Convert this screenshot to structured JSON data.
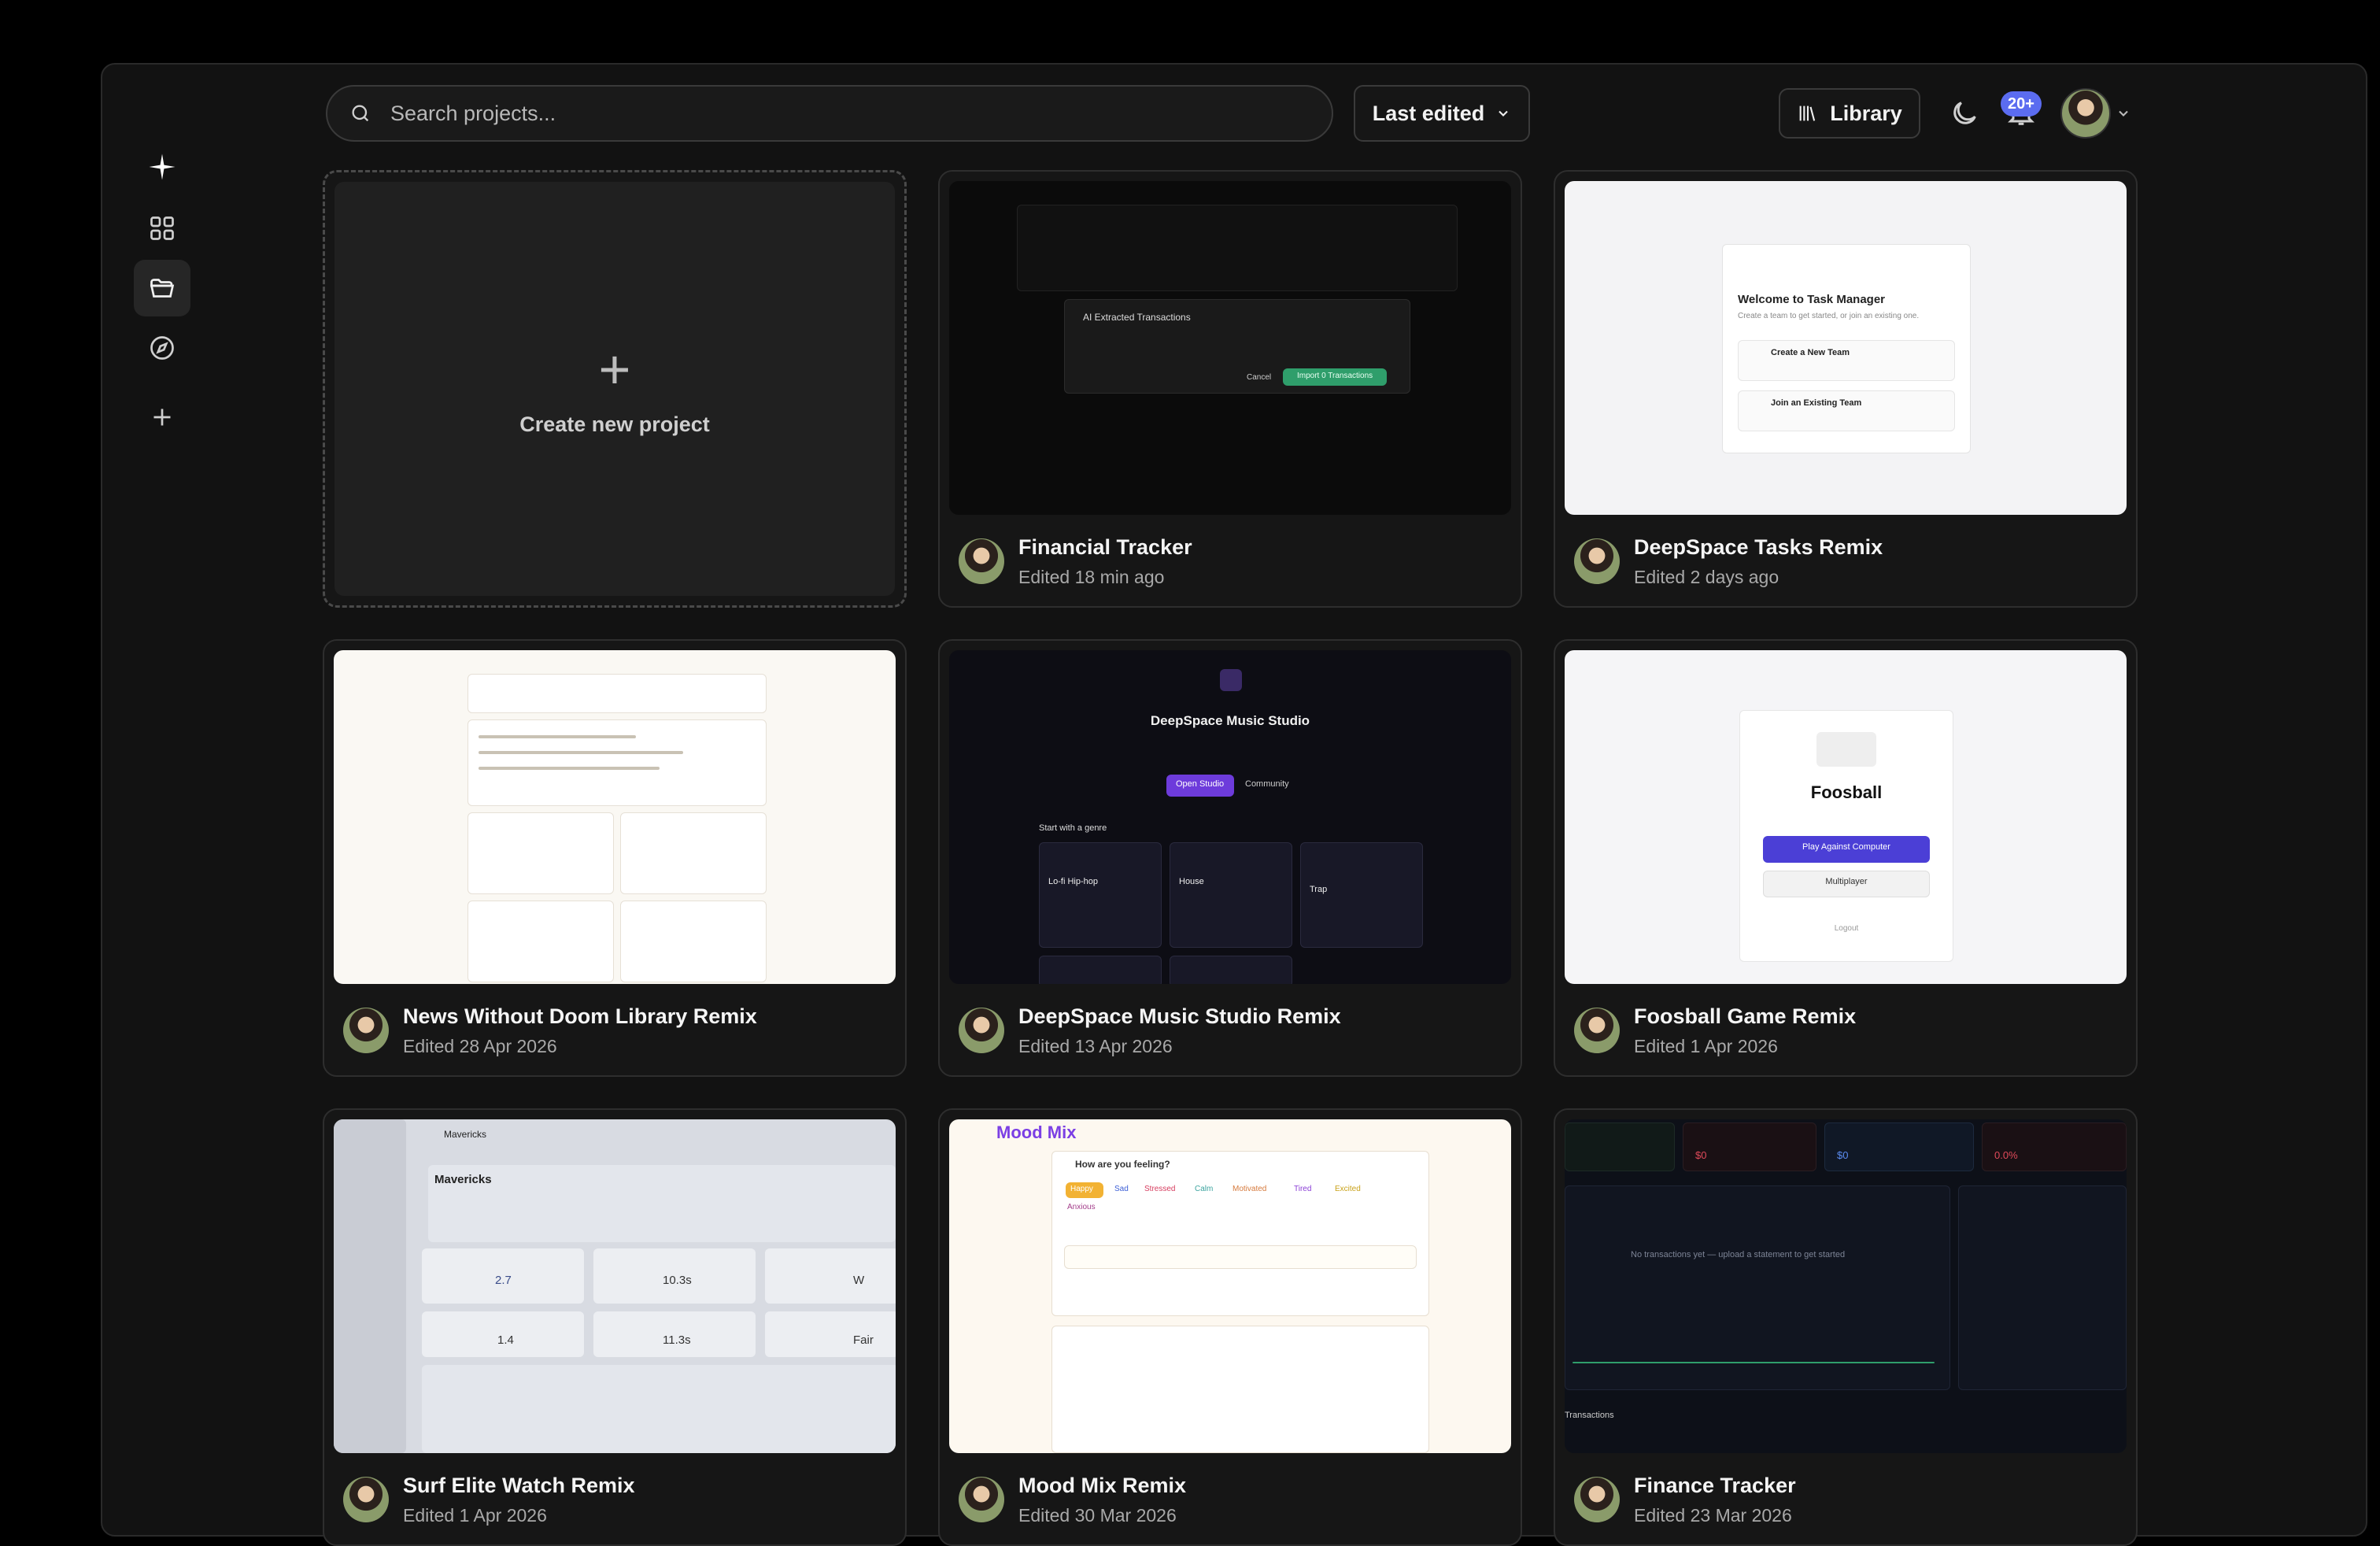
{
  "sidebar": {
    "items": [
      {
        "name": "logo",
        "icon": "sparkle-icon"
      },
      {
        "name": "apps",
        "icon": "grid-icon"
      },
      {
        "name": "projects",
        "icon": "folder-icon",
        "active": true
      },
      {
        "name": "explore",
        "icon": "compass-icon"
      },
      {
        "name": "new",
        "icon": "plus-icon"
      }
    ]
  },
  "header": {
    "search_placeholder": "Search projects...",
    "sort_label": "Last edited",
    "library_label": "Library",
    "notifications_count": "20+"
  },
  "create_card": {
    "label": "Create new project"
  },
  "projects": [
    {
      "title": "Financial Tracker",
      "edited": "Edited 18 min ago"
    },
    {
      "title": "DeepSpace Tasks Remix",
      "edited": "Edited 2 days ago"
    },
    {
      "title": "News Without Doom Library Remix",
      "edited": "Edited 28 Apr 2026"
    },
    {
      "title": "DeepSpace Music Studio Remix",
      "edited": "Edited 13 Apr 2026"
    },
    {
      "title": "Foosball Game Remix",
      "edited": "Edited 1 Apr 2026"
    },
    {
      "title": "Surf Elite Watch Remix",
      "edited": "Edited 1 Apr 2026"
    },
    {
      "title": "Mood Mix Remix",
      "edited": "Edited 30 Mar 2026"
    },
    {
      "title": "Finance Tracker",
      "edited": "Edited 23 Mar 2026"
    }
  ],
  "thumbs": {
    "financial": {
      "dialog_title": "AI Extracted Transactions",
      "cancel": "Cancel",
      "import": "Import 0 Transactions"
    },
    "tasks": {
      "title": "Welcome to Task Manager",
      "subtitle": "Create a team to get started, or join an existing one.",
      "opt1": "Create a New Team",
      "opt2": "Join an Existing Team"
    },
    "music": {
      "title": "DeepSpace Music Studio",
      "open": "Open Studio",
      "community": "Community",
      "genre": "Start with a genre",
      "g1": "Lo-fi Hip-hop",
      "g2": "House",
      "g3": "Trap"
    },
    "foosball": {
      "title": "Foosball",
      "play": "Play Against Computer",
      "multi": "Multiplayer",
      "logout": "Logout"
    },
    "surf": {
      "spot": "Mavericks",
      "wave": "2.7",
      "period": "10.3s",
      "dir": "W",
      "swell": "1.4",
      "swell2": "11.3s",
      "quality": "Fair"
    },
    "mood": {
      "title": "Mood Mix",
      "question": "How are you feeling?",
      "moods": [
        "Happy",
        "Sad",
        "Stressed",
        "Calm",
        "Motivated",
        "Tired",
        "Excited",
        "Anxious"
      ]
    },
    "finance": {
      "m1": "$0",
      "m2": "$0",
      "m3": "0.0%",
      "empty": "No transactions yet — upload a statement to get started",
      "trans": "Transactions"
    }
  },
  "colors": {
    "accent": "#5b6cf0",
    "background": "#121212",
    "card": "#161616"
  }
}
